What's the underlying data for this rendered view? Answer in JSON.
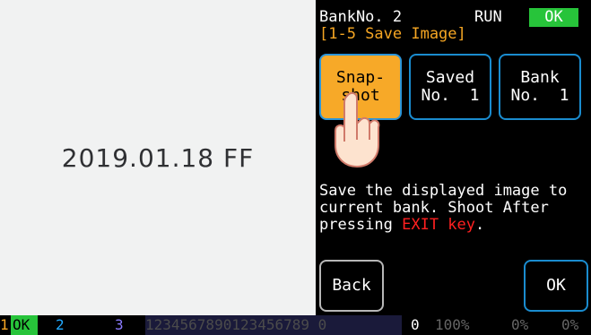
{
  "capture": {
    "text": "2019.01.18 FF"
  },
  "header": {
    "bank_line": "BankNo. 2",
    "menu_title": "[1-5 Save Image]",
    "run_label": "RUN",
    "ok_badge": "OK"
  },
  "buttons": {
    "snapshot": {
      "line1": "Snap-",
      "line2": "shot"
    },
    "saved": {
      "line1": "Saved",
      "line2": "No.  1"
    },
    "bank": {
      "line1": "Bank",
      "line2": "No.  1"
    },
    "back": "Back",
    "ok": "OK"
  },
  "message": {
    "part1": "Save the displayed image to current bank.  Shoot After pressing ",
    "exit_key": "EXIT key",
    "part2": "."
  },
  "status_bar": {
    "slot1_num": "1",
    "slot1_ok": "OK",
    "slot2_num": "2",
    "slot3_num": "3",
    "digits": "1234567890123456789 0",
    "zero": "0",
    "pct_a": "100%",
    "pct_b": "0%",
    "pct_c": "0%"
  },
  "colors": {
    "accent_orange": "#f7a928",
    "status_green": "#27c43a",
    "border_blue": "#1a8ccf",
    "warning_red": "#ff2020"
  }
}
